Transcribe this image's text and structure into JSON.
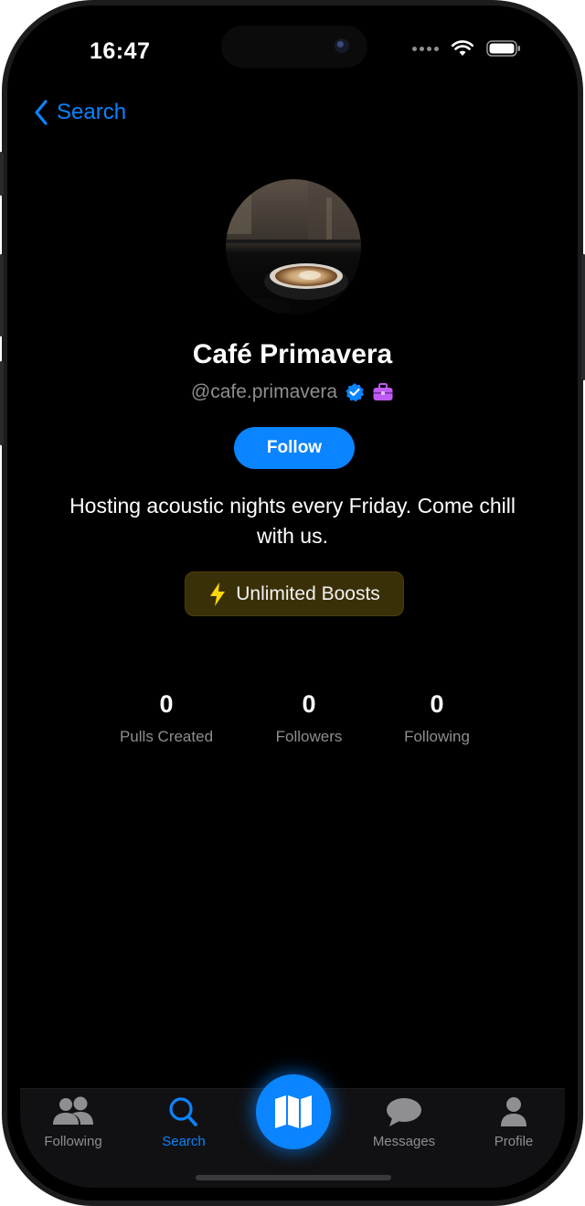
{
  "status_bar": {
    "time": "16:47"
  },
  "nav": {
    "back_label": "Search"
  },
  "profile": {
    "name": "Café Primavera",
    "handle": "@cafe.primavera",
    "follow_label": "Follow",
    "bio": "Hosting acoustic nights every Friday. Come chill with us.",
    "boost_label": "Unlimited Boosts"
  },
  "stats": [
    {
      "value": "0",
      "label": "Pulls Created"
    },
    {
      "value": "0",
      "label": "Followers"
    },
    {
      "value": "0",
      "label": "Following"
    }
  ],
  "tabbar": {
    "tabs": [
      {
        "label": "Following",
        "icon": "people-icon"
      },
      {
        "label": "Search",
        "icon": "search-icon"
      },
      {
        "label": "",
        "icon": "map-icon"
      },
      {
        "label": "Messages",
        "icon": "chat-bubble-icon"
      },
      {
        "label": "Profile",
        "icon": "person-icon"
      }
    ]
  },
  "colors": {
    "accent": "#0a84ff",
    "background": "#000000",
    "secondary_text": "#8e8e93",
    "boost_bg": "#3a3008",
    "business_badge": "#bf5af2"
  }
}
